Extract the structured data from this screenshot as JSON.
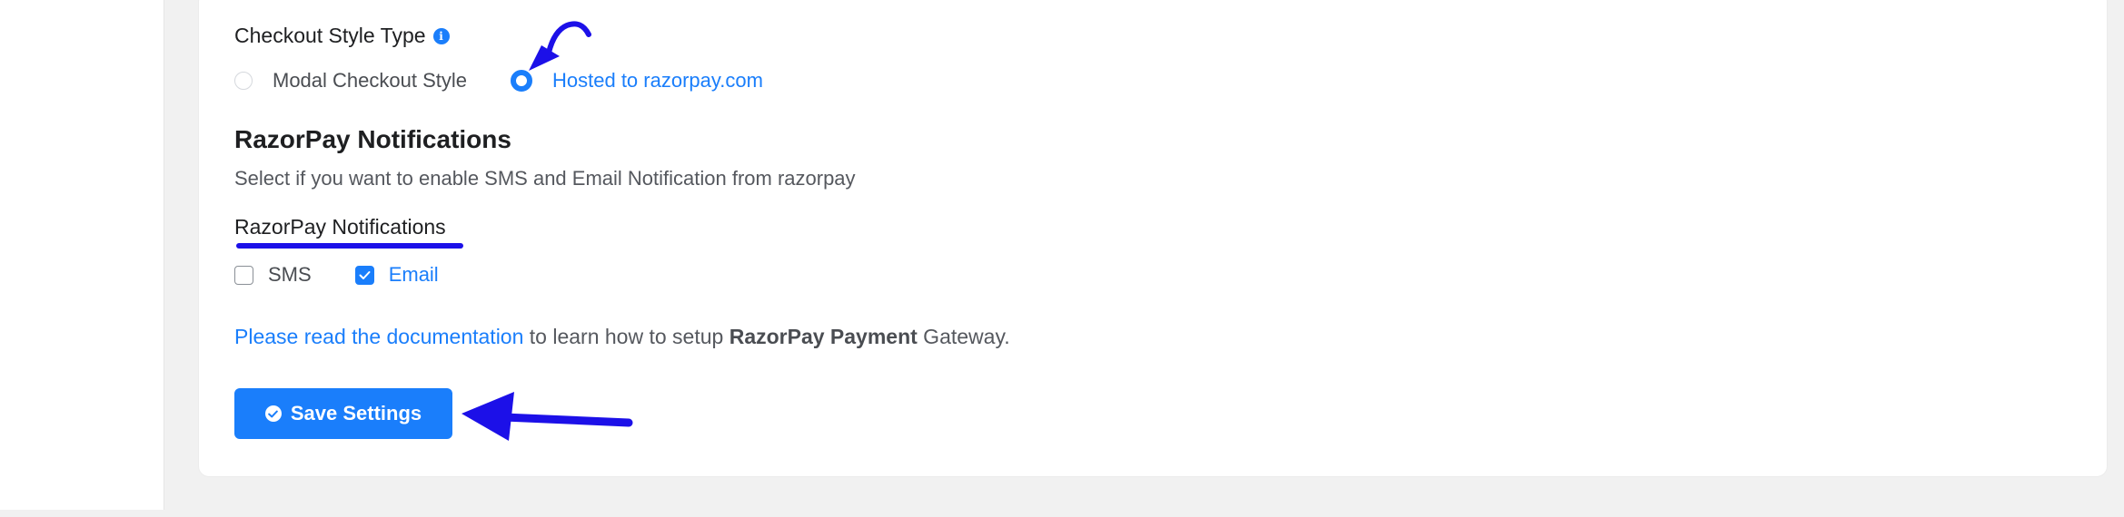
{
  "checkout_style": {
    "label": "Checkout Style Type",
    "info_icon": "info-icon",
    "options": [
      {
        "label": "Modal Checkout Style",
        "selected": false
      },
      {
        "label": "Hosted to razorpay.com",
        "selected": true
      }
    ]
  },
  "notifications": {
    "title": "RazorPay Notifications",
    "description": "Select if you want to enable SMS and Email Notification from razorpay",
    "field_label": "RazorPay Notifications",
    "options": [
      {
        "label": "SMS",
        "checked": false
      },
      {
        "label": "Email",
        "checked": true
      }
    ]
  },
  "documentation": {
    "link_text": "Please read the documentation",
    "text_middle": " to learn how to setup ",
    "bold_text": "RazorPay Payment",
    "text_end": " Gateway."
  },
  "save_button": {
    "label": "Save Settings",
    "icon": "check-circle-icon"
  },
  "colors": {
    "primary": "#1a7efb",
    "annotation": "#1c10e8",
    "background": "#f1f1f1"
  }
}
